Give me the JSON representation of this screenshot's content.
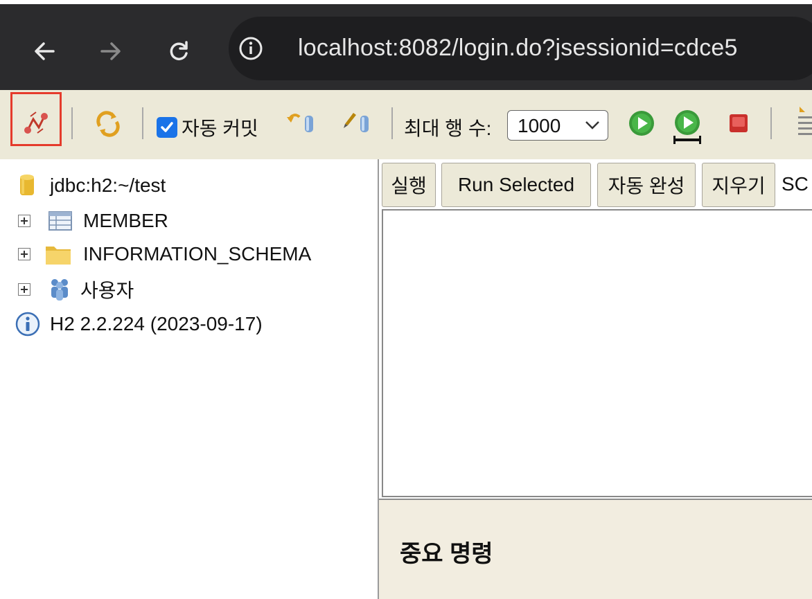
{
  "browser": {
    "url": "localhost:8082/login.do?jsessionid=cdce5"
  },
  "toolbar": {
    "auto_commit_label": "자동 커밋",
    "auto_commit_checked": true,
    "max_rows_label": "최대 행 수:",
    "max_rows_value": "1000"
  },
  "tree": {
    "connection": "jdbc:h2:~/test",
    "items": [
      {
        "label": "MEMBER",
        "icon": "table-icon"
      },
      {
        "label": "INFORMATION_SCHEMA",
        "icon": "folder-icon"
      },
      {
        "label": "사용자",
        "icon": "users-icon"
      }
    ],
    "version": "H2 2.2.224 (2023-09-17)"
  },
  "sql_buttons": {
    "run": "실행",
    "run_selected": "Run Selected",
    "auto_complete": "자동 완성",
    "clear": "지우기",
    "sql_label": "SC"
  },
  "help": {
    "heading": "중요 명령"
  },
  "colors": {
    "chrome_bg": "#2b2b2d",
    "toolbar_bg": "#ece9d8",
    "highlight": "#e53b2c",
    "checkbox": "#1a73e8"
  }
}
